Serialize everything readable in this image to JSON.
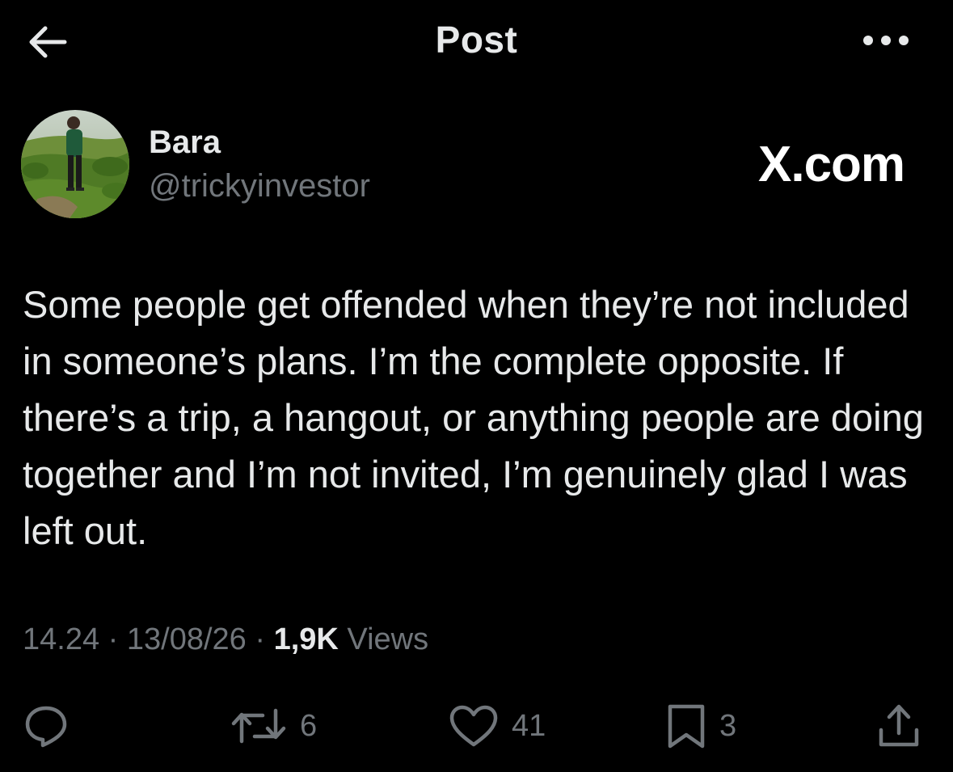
{
  "header": {
    "title": "Post",
    "back_icon": "arrow-left-icon",
    "more_icon": "more-horizontal-icon"
  },
  "author": {
    "display_name": "Bara",
    "handle": "@trickyinvestor"
  },
  "watermark": "X.com",
  "tweet": {
    "text": "Some people get offended when they’re not included in someone’s plans. I’m the complete opposite. If there’s a trip, a hangout, or anything people are doing together and I’m not invited, I’m genuinely glad I was left out."
  },
  "meta": {
    "time": "14.24",
    "date": "13/08/26",
    "separator": "·",
    "views_count": "1,9K",
    "views_label": "Views"
  },
  "actions": {
    "reply": {
      "icon": "reply-icon",
      "count": ""
    },
    "repost": {
      "icon": "repost-icon",
      "count": "6"
    },
    "like": {
      "icon": "heart-icon",
      "count": "41"
    },
    "bookmark": {
      "icon": "bookmark-icon",
      "count": "3"
    },
    "share": {
      "icon": "share-icon",
      "count": ""
    }
  },
  "colors": {
    "background": "#000000",
    "primary_text": "#e7e9ea",
    "secondary_text": "#71767b"
  }
}
